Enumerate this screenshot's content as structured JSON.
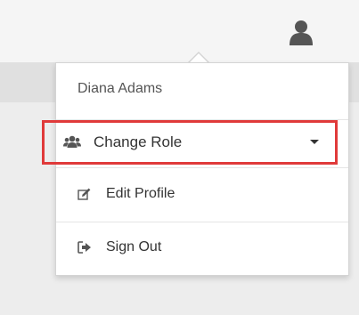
{
  "menu": {
    "user_name": "Diana Adams",
    "items": [
      {
        "label": "Change Role",
        "icon": "users-icon"
      },
      {
        "label": "Edit Profile",
        "icon": "edit-icon"
      },
      {
        "label": "Sign Out",
        "icon": "sign-out-icon"
      }
    ]
  },
  "colors": {
    "highlight_border": "#e03a3a",
    "icon": "#555555"
  }
}
